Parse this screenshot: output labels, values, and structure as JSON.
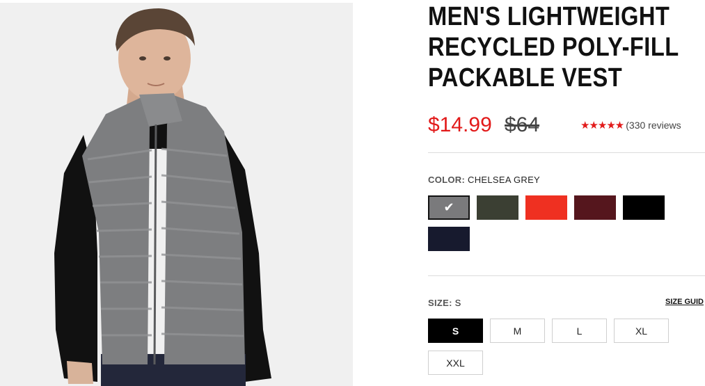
{
  "product": {
    "title_lines": [
      "MEN'S LIGHTWEIGHT",
      "RECYCLED POLY-FILL",
      "PACKABLE VEST"
    ],
    "price_sale": "$14.99",
    "price_original": "$64",
    "stars": "★★★★★",
    "rating_value": 5,
    "reviews": "(330 reviews"
  },
  "color": {
    "label": "COLOR:",
    "selected": "CHELSEA GREY",
    "swatches": [
      {
        "hex": "#7a7a7c",
        "selected": true
      },
      {
        "hex": "#3b3f33",
        "selected": false
      },
      {
        "hex": "#ef3021",
        "selected": false
      },
      {
        "hex": "#55161d",
        "selected": false
      },
      {
        "hex": "#000000",
        "selected": false
      },
      {
        "hex": "#171a2e",
        "selected": false
      }
    ],
    "check_icon": "check-icon"
  },
  "size": {
    "label": "SIZE:",
    "selected": "S",
    "guide": "SIZE GUID",
    "options": [
      "S",
      "M",
      "L",
      "XL",
      "XXL"
    ]
  },
  "colors": {
    "sale": "#e21a1a",
    "photo_bg": "#f0f0f0"
  }
}
